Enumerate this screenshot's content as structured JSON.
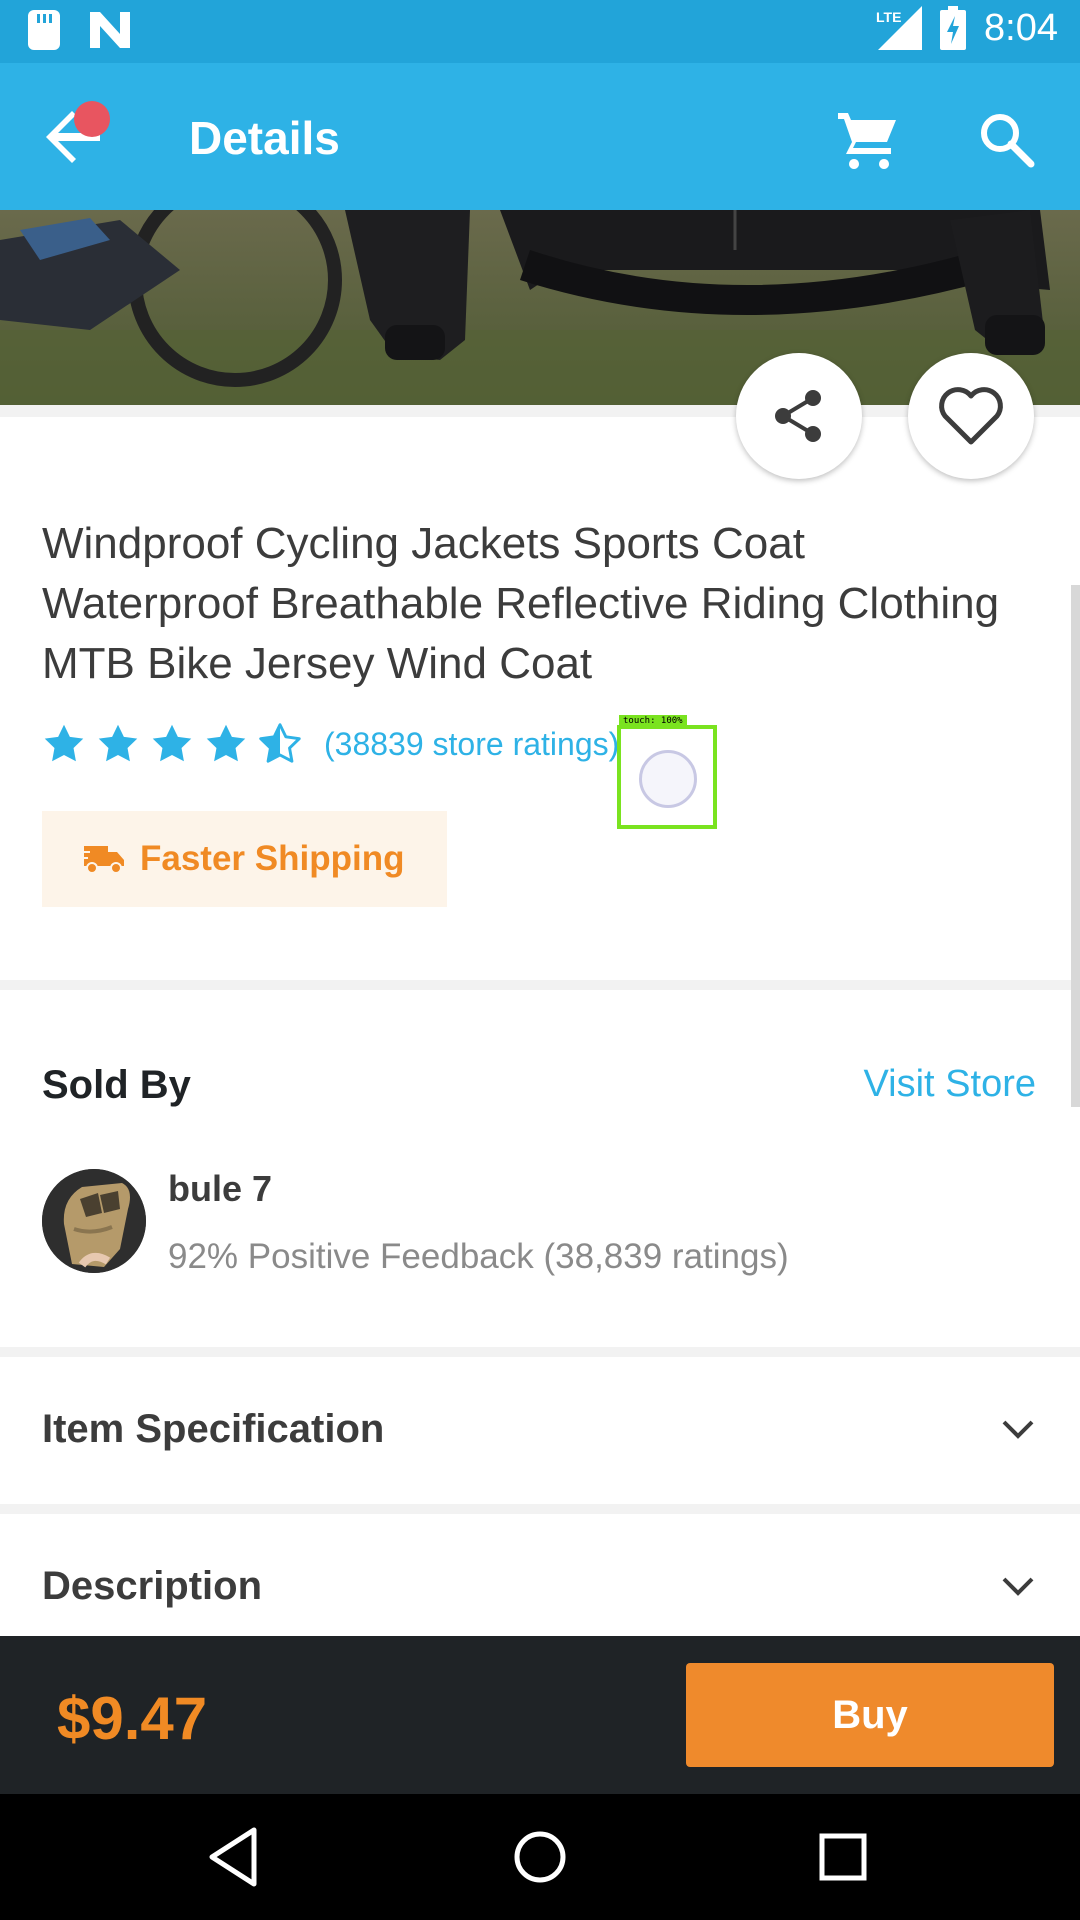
{
  "status_bar": {
    "time": "8:04",
    "network": "LTE",
    "icons": [
      "sd-card-icon",
      "n-app-icon",
      "lte-signal-icon",
      "battery-charging-icon"
    ]
  },
  "app_bar": {
    "title": "Details",
    "icons": [
      "back-arrow-icon",
      "cart-icon",
      "search-icon"
    ]
  },
  "product": {
    "title": "Windproof Cycling Jackets Sports Coat Waterproof Breathable Reflective Riding Clothing MTB Bike Jersey Wind Coat",
    "rating": 4.5,
    "ratings_text": "(38839 store ratings)",
    "shipping_badge": "Faster Shipping"
  },
  "seller": {
    "section_title": "Sold By",
    "visit_store": "Visit Store",
    "name": "bule 7",
    "feedback": "92% Positive Feedback (38,839 ratings)"
  },
  "sections": {
    "item_specification": "Item Specification",
    "description": "Description"
  },
  "bottom_bar": {
    "price": "$9.47",
    "buy_label": "Buy"
  },
  "touch_overlay": {
    "label": "touch: 100%"
  },
  "colors": {
    "accent": "#2eb2e6",
    "status_bar": "#22a4d9",
    "orange": "#f08a24",
    "dark": "#1f2326"
  }
}
